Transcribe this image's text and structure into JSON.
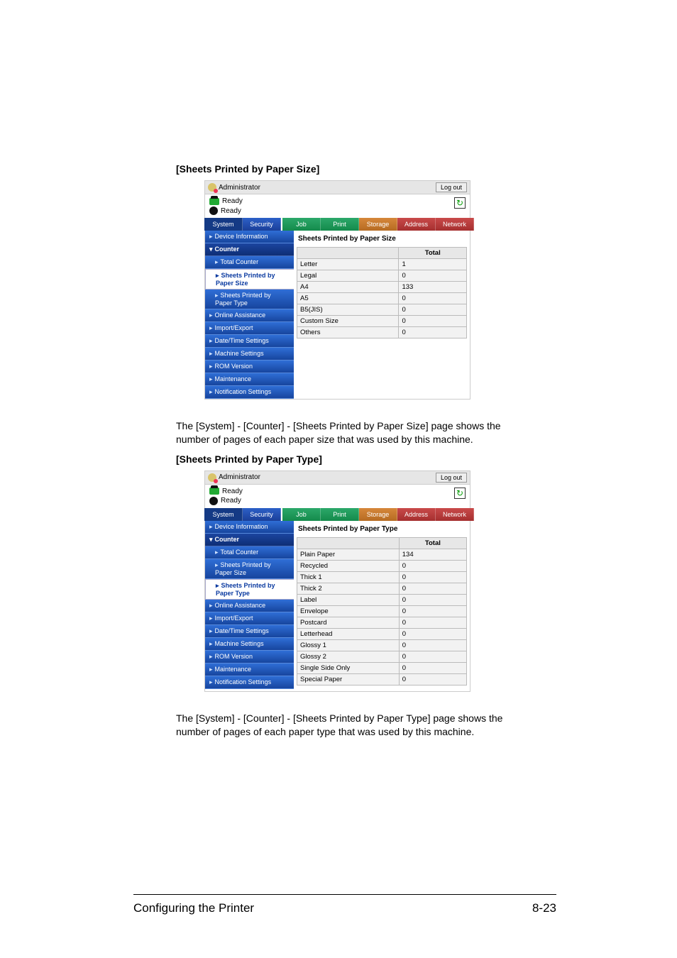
{
  "section1_title": "[Sheets Printed by Paper Size]",
  "section2_title": "[Sheets Printed by Paper Type]",
  "app": {
    "user_label": "Administrator",
    "logout": "Log out",
    "status1": "Ready",
    "status2": "Ready"
  },
  "tabs": {
    "system": "System",
    "security": "Security",
    "job": "Job",
    "print": "Print",
    "storage": "Storage",
    "address": "Address",
    "network": "Network"
  },
  "sidebar_common": {
    "device_info": "Device Information",
    "counter": "Counter",
    "total_counter": "Total Counter",
    "by_size": "Sheets Printed by Paper Size",
    "by_type": "Sheets Printed by Paper Type",
    "online_assist": "Online Assistance",
    "import_export": "Import/Export",
    "date_time": "Date/Time Settings",
    "machine": "Machine Settings",
    "rom": "ROM Version",
    "maintenance": "Maintenance",
    "notification": "Notification Settings"
  },
  "panel1": {
    "title": "Sheets Printed by Paper Size",
    "col_total": "Total",
    "rows": [
      {
        "label": "Letter",
        "value": "1"
      },
      {
        "label": "Legal",
        "value": "0"
      },
      {
        "label": "A4",
        "value": "133"
      },
      {
        "label": "A5",
        "value": "0"
      },
      {
        "label": "B5(JIS)",
        "value": "0"
      },
      {
        "label": "Custom Size",
        "value": "0"
      },
      {
        "label": "Others",
        "value": "0"
      }
    ]
  },
  "panel2": {
    "title": "Sheets Printed by Paper Type",
    "col_total": "Total",
    "rows": [
      {
        "label": "Plain Paper",
        "value": "134"
      },
      {
        "label": "Recycled",
        "value": "0"
      },
      {
        "label": "Thick 1",
        "value": "0"
      },
      {
        "label": "Thick 2",
        "value": "0"
      },
      {
        "label": "Label",
        "value": "0"
      },
      {
        "label": "Envelope",
        "value": "0"
      },
      {
        "label": "Postcard",
        "value": "0"
      },
      {
        "label": "Letterhead",
        "value": "0"
      },
      {
        "label": "Glossy 1",
        "value": "0"
      },
      {
        "label": "Glossy 2",
        "value": "0"
      },
      {
        "label": "Single Side Only",
        "value": "0"
      },
      {
        "label": "Special Paper",
        "value": "0"
      }
    ]
  },
  "para1": "The [System] - [Counter] - [Sheets Printed by Paper Size] page shows the number of pages of each paper size that was used by this machine.",
  "para2": "The [System] - [Counter] - [Sheets Printed by Paper Type] page shows the number of pages of each paper type that was used by this machine.",
  "footer_left": "Configuring the Printer",
  "footer_right": "8-23"
}
